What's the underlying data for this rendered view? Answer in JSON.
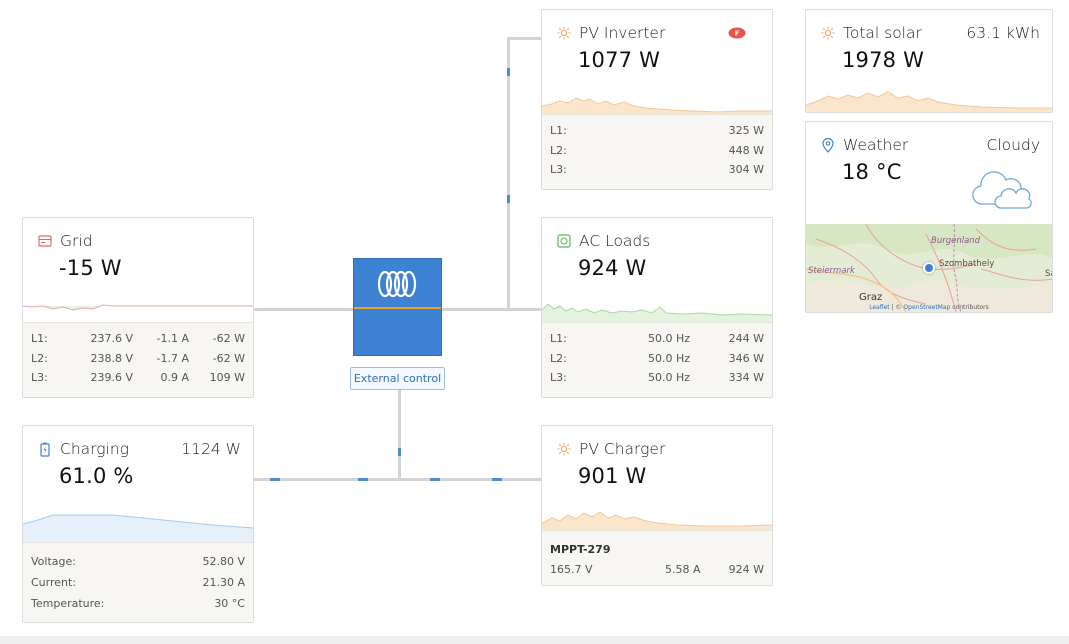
{
  "pv_inverter": {
    "title": "PV Inverter",
    "value": "1077 W",
    "rows": [
      [
        "L1:",
        "325 W"
      ],
      [
        "L2:",
        "448 W"
      ],
      [
        "L3:",
        "304 W"
      ]
    ]
  },
  "total_solar": {
    "title": "Total solar",
    "energy": "63.1 kWh",
    "value": "1978 W"
  },
  "weather": {
    "title": "Weather",
    "condition": "Cloudy",
    "temperature": "18 °C"
  },
  "map": {
    "labels": {
      "burgenland": "Burgenland",
      "szombathely": "Szombathely",
      "steiermark": "Steiermark",
      "graz": "Graz",
      "edge": "Sa"
    },
    "attribution": {
      "leaflet": "Leaflet",
      "sep": " | © ",
      "osm": "OpenStreetMap",
      "suffix": " contributors"
    }
  },
  "grid": {
    "title": "Grid",
    "value": "-15 W",
    "rows": [
      [
        "L1:",
        "237.6 V",
        "-1.1 A",
        "-62 W"
      ],
      [
        "L2:",
        "238.8 V",
        "-1.7 A",
        "-62 W"
      ],
      [
        "L3:",
        "239.6 V",
        "0.9 A",
        "109 W"
      ]
    ]
  },
  "ac_loads": {
    "title": "AC Loads",
    "value": "924 W",
    "rows": [
      [
        "L1:",
        "50.0 Hz",
        "244 W"
      ],
      [
        "L2:",
        "50.0 Hz",
        "346 W"
      ],
      [
        "L3:",
        "50.0 Hz",
        "334 W"
      ]
    ]
  },
  "inverter": {
    "external_control": "External control"
  },
  "battery": {
    "title": "Charging",
    "power": "1124 W",
    "soc": "61.0 %",
    "rows": [
      [
        "Voltage:",
        "52.80 V"
      ],
      [
        "Current:",
        "21.30 A"
      ],
      [
        "Temperature:",
        "30 °C"
      ]
    ]
  },
  "pv_charger": {
    "title": "PV Charger",
    "value": "901 W",
    "device": "MPPT-279",
    "stats": [
      "165.7 V",
      "5.58 A",
      "924 W"
    ]
  },
  "colors": {
    "solar_fill": "#fbe6cc",
    "solar_line": "#f2c79a",
    "grid_line": "#e8a6a0",
    "load_fill": "#e3f3df",
    "load_line": "#a9d9a0",
    "battery_fill": "#e6f0fa",
    "battery_line": "#a8c9ea",
    "brand_blue": "#3d82d2",
    "flow_blue": "#4a8fd6"
  }
}
